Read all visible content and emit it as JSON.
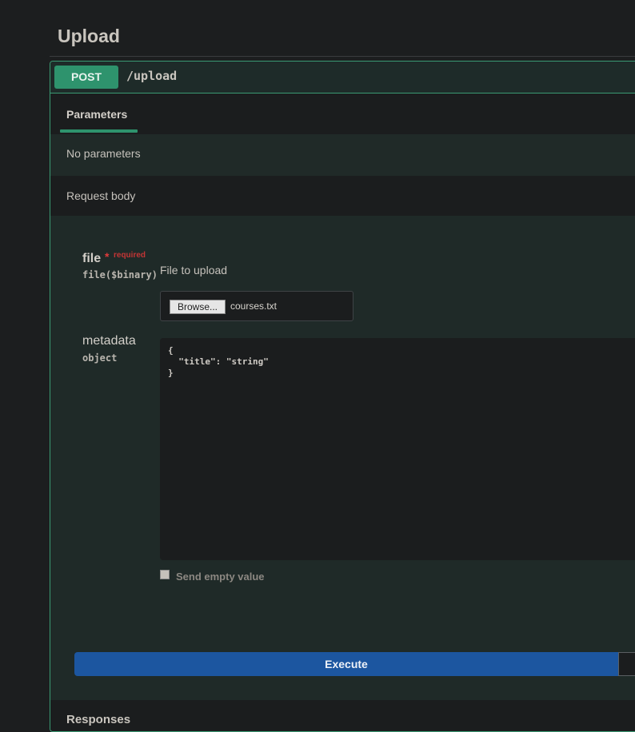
{
  "section": {
    "title": "Upload"
  },
  "operation": {
    "method": "POST",
    "path": "/upload"
  },
  "tabs": {
    "parameters_label": "Parameters"
  },
  "parameters": {
    "empty_text": "No parameters"
  },
  "request_body": {
    "label": "Request body",
    "file_field": {
      "name": "file",
      "required_star": "*",
      "required_label": "required",
      "type": "file($binary)",
      "description": "File to upload",
      "browse_label": "Browse...",
      "chosen_file": "courses.txt"
    },
    "metadata_field": {
      "name": "metadata",
      "type": "object",
      "json_lines": [
        "{",
        "  \"title\": \"string\"",
        "}"
      ]
    },
    "send_empty_label": "Send empty value"
  },
  "execute_label": "Execute",
  "responses_label": "Responses",
  "colors": {
    "method_post": "#2e936d",
    "execute": "#1c56a0",
    "required": "#c43535"
  }
}
